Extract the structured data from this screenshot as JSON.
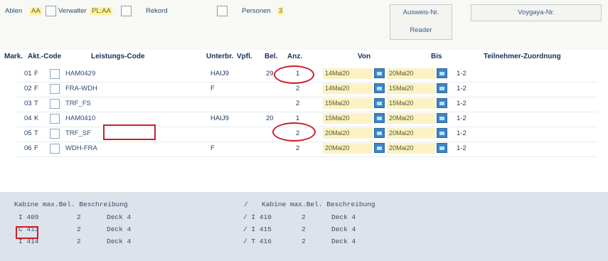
{
  "toolbar": {
    "label_a": "Ablen",
    "value_a": "AA",
    "label_b": "Verwalter",
    "value_b": "PL:AA",
    "label_c": "Rekord",
    "label_d": "Personen",
    "value_d": "3",
    "button_1": "Ausweis-Nr.",
    "button_1_sub": "Reader",
    "button_2": "Voygaya-Nr."
  },
  "columns": {
    "mark": "Mark.",
    "akt_code": "Akt.-Code",
    "leistungs_code": "Leistungs-Code",
    "unterbr": "Unterbr.",
    "vpfl": "Vpfl.",
    "bel": "Bel.",
    "anz": "Anz.",
    "von": "Von",
    "bis": "Bis",
    "teilnehmer": "Teilnehmer-Zuordnung"
  },
  "rows": [
    {
      "mark": "01",
      "akt": "F",
      "code": "HAM0429",
      "unterbr": "HAIJ9",
      "bel": "29",
      "anz": "1",
      "von": "14Mai20",
      "bis": "20Mai20",
      "teil": "1-2"
    },
    {
      "mark": "02",
      "akt": "F",
      "code": "FRA-WDH",
      "unterbr": "F",
      "bel": "",
      "anz": "2",
      "von": "14Mai20",
      "bis": "15Mai20",
      "teil": "1-2"
    },
    {
      "mark": "03",
      "akt": "T",
      "code": "TRF_FS",
      "unterbr": "",
      "bel": "",
      "anz": "2",
      "von": "15Mai20",
      "bis": "15Mai20",
      "teil": "1-2"
    },
    {
      "mark": "04",
      "akt": "K",
      "code": "HAM0410",
      "unterbr": "HAIJ9",
      "bel": "20",
      "anz": "1",
      "von": "15Mai20",
      "bis": "20Mai20",
      "teil": "1-2"
    },
    {
      "mark": "05",
      "akt": "T",
      "code": "TRF_SF",
      "unterbr": "",
      "bel": "",
      "anz": "2",
      "von": "20Mai20",
      "bis": "20Mai20",
      "teil": "1-2"
    },
    {
      "mark": "06",
      "akt": "F",
      "code": "WDH-FRA",
      "unterbr": "F",
      "bel": "",
      "anz": "2",
      "von": "20Mai20",
      "bis": "20Mai20",
      "teil": "1-2"
    }
  ],
  "bottom": {
    "header_left": "Kabine max.Bel.  Beschreibung",
    "separator": "/",
    "header_right": "Kabine max.Bel.  Beschreibung",
    "left": [
      {
        "kab": "I 409",
        "max": "2",
        "desc": "Deck 4"
      },
      {
        "kab": "C 413",
        "max": "2",
        "desc": "Deck 4"
      },
      {
        "kab": "I 414",
        "max": "2",
        "desc": "Deck 4"
      }
    ],
    "right": [
      {
        "kab": "/ I 410",
        "max": "2",
        "desc": "Deck 4"
      },
      {
        "kab": "/ I 415",
        "max": "2",
        "desc": "Deck 4"
      },
      {
        "kab": "/ T 416",
        "max": "2",
        "desc": "Deck 4"
      }
    ]
  },
  "colors": {
    "annotation": "#cc1f2a",
    "date_bg": "#fbf3c4",
    "calendar": "#3a86c8",
    "bottom_panel": "#dde3ea"
  }
}
